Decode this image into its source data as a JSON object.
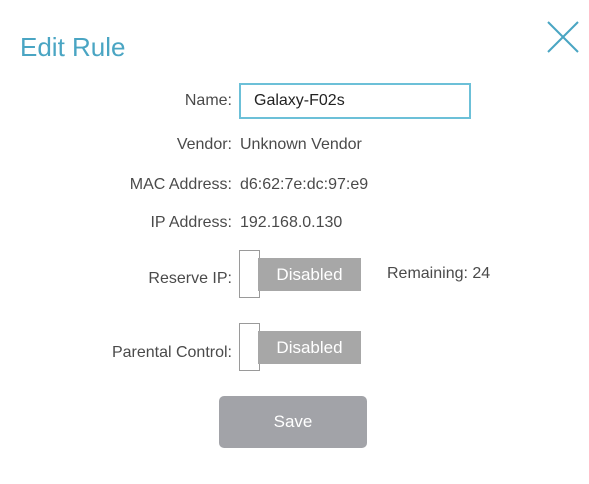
{
  "dialog": {
    "title": "Edit Rule",
    "close_icon": "close-icon"
  },
  "fields": {
    "name": {
      "label": "Name:",
      "value": "Galaxy-F02s"
    },
    "vendor": {
      "label": "Vendor:",
      "value": "Unknown Vendor"
    },
    "mac": {
      "label": "MAC Address:",
      "value": "d6:62:7e:dc:97:e9"
    },
    "ip": {
      "label": "IP Address:",
      "value": "192.168.0.130"
    },
    "reserve_ip": {
      "label": "Reserve IP:",
      "state": "Disabled",
      "remaining": "Remaining: 24"
    },
    "parental_control": {
      "label": "Parental Control:",
      "state": "Disabled"
    }
  },
  "actions": {
    "save_label": "Save"
  },
  "colors": {
    "title": "#4aa5c3",
    "input_border": "#6cc0d8",
    "toggle_off": "#a7a7a7",
    "save_button": "#a2a3a8"
  }
}
